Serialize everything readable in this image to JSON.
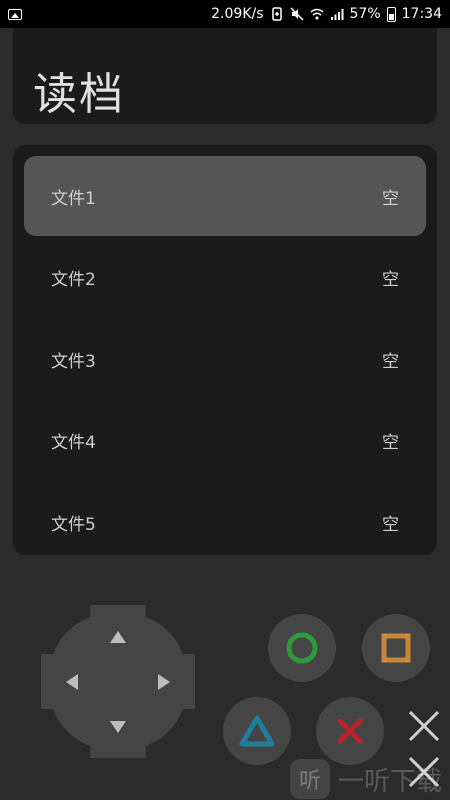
{
  "status_bar": {
    "speed": "2.09K/s",
    "battery_percent": "57%",
    "time": "17:34",
    "icons": [
      "gallery-icon",
      "battery-saver-icon",
      "mute-icon",
      "wifi-icon",
      "signal-icon",
      "battery-icon"
    ]
  },
  "header": {
    "title": "读档"
  },
  "save_slots": [
    {
      "name": "文件1",
      "status": "空",
      "selected": true
    },
    {
      "name": "文件2",
      "status": "空",
      "selected": false
    },
    {
      "name": "文件3",
      "status": "空",
      "selected": false
    },
    {
      "name": "文件4",
      "status": "空",
      "selected": false
    },
    {
      "name": "文件5",
      "status": "空",
      "selected": false
    }
  ],
  "controls": {
    "dpad": [
      "up",
      "down",
      "left",
      "right"
    ],
    "buttons": [
      {
        "name": "circle",
        "color": "#2e9a3a"
      },
      {
        "name": "square",
        "color": "#c7883a"
      },
      {
        "name": "triangle",
        "color": "#1f7f9a"
      },
      {
        "name": "cross",
        "color": "#b8232a"
      }
    ]
  },
  "watermark": {
    "logo_char": "听",
    "text": "一听下载"
  }
}
